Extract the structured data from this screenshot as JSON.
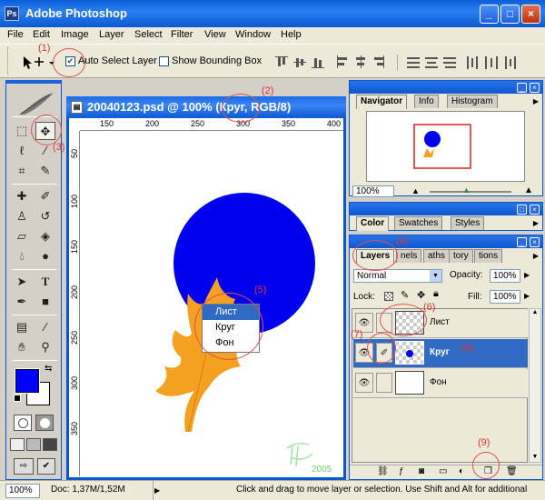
{
  "window": {
    "title": "Adobe Photoshop",
    "app_icon": "Ps"
  },
  "menu": [
    "File",
    "Edit",
    "Image",
    "Layer",
    "Select",
    "Filter",
    "View",
    "Window",
    "Help"
  ],
  "options": {
    "auto_select_layer": "Auto Select Layer",
    "auto_select_checked": true,
    "show_bounding_box": "Show Bounding Box",
    "show_bounding_checked": false
  },
  "document": {
    "title": "20040123.psd @ 100% (Круг, RGB/8)",
    "ruler_h": [
      "150",
      "200",
      "250",
      "300",
      "350",
      "400"
    ],
    "ruler_v": [
      "50",
      "100",
      "150",
      "200",
      "250",
      "300",
      "350"
    ],
    "signature_year": "2005"
  },
  "context_menu": {
    "items": [
      "Лист",
      "Круг",
      "Фон"
    ],
    "highlighted": 0
  },
  "navigator": {
    "tabs": [
      "Navigator",
      "Info",
      "Histogram"
    ],
    "zoom": "100%"
  },
  "color_panel": {
    "tabs": [
      "Color",
      "Swatches",
      "Styles"
    ]
  },
  "layers_panel": {
    "tabs": [
      "Layers",
      "Channels",
      "Paths",
      "History",
      "Actions"
    ],
    "tab_labels_visible": [
      "Layers",
      "nels",
      "aths",
      "tory",
      "tions"
    ],
    "blend_mode": "Normal",
    "opacity_label": "Opacity:",
    "opacity": "100%",
    "lock_label": "Lock:",
    "fill_label": "Fill:",
    "fill": "100%",
    "layers": [
      {
        "name": "Лист",
        "selected": false
      },
      {
        "name": "Круг",
        "selected": true
      },
      {
        "name": "Фон",
        "selected": false
      }
    ]
  },
  "annotations": [
    "(1)",
    "(2)",
    "(3)",
    "(4)",
    "(5)",
    "(6)",
    "(7)",
    "(8)",
    "(9)"
  ],
  "status": {
    "zoom": "100%",
    "doc": "Doc: 1,37M/1,52M",
    "hint": "Click and drag to move layer or selection. Use Shift and Alt for additional"
  },
  "colors": {
    "circle": "#0000ee",
    "leaf": "#f4a020",
    "foreground": "#0000ff",
    "background": "#ffffff",
    "title_blue": "#0a58d0",
    "annotation_red": "#e23030",
    "selection_blue": "#316ac5"
  }
}
